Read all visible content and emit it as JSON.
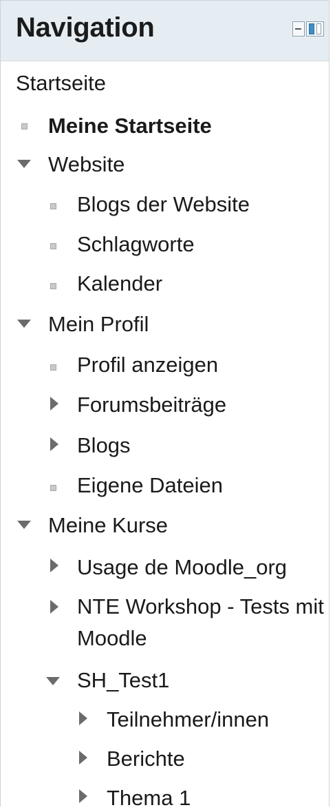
{
  "block": {
    "title": "Navigation",
    "controls": {
      "collapse_icon": "minus-box-icon",
      "dock_icon": "dock-block-icon"
    }
  },
  "tree": [
    {
      "label": "Startseite",
      "icon": "none"
    },
    {
      "label": "Meine Startseite",
      "icon": "bullet"
    },
    {
      "label": "Website",
      "icon": "expanded-arrow"
    },
    {
      "label": "Blogs der Website",
      "icon": "bullet"
    },
    {
      "label": "Schlagworte",
      "icon": "bullet"
    },
    {
      "label": "Kalender",
      "icon": "bullet"
    },
    {
      "label": "Mein Profil",
      "icon": "expanded-arrow"
    },
    {
      "label": "Profil anzeigen",
      "icon": "bullet"
    },
    {
      "label": "Forumsbeiträge",
      "icon": "collapsed-arrow"
    },
    {
      "label": "Blogs",
      "icon": "collapsed-arrow"
    },
    {
      "label": "Eigene Dateien",
      "icon": "bullet"
    },
    {
      "label": "Meine Kurse",
      "icon": "expanded-arrow"
    },
    {
      "label": "Usage de Moodle_org",
      "icon": "collapsed-arrow"
    },
    {
      "label": "NTE Workshop - Tests mit Moodle",
      "icon": "collapsed-arrow"
    },
    {
      "label": "SH_Test1",
      "icon": "expanded-arrow"
    },
    {
      "label": "Teilnehmer/innen",
      "icon": "collapsed-arrow"
    },
    {
      "label": "Berichte",
      "icon": "collapsed-arrow"
    },
    {
      "label": "Thema 1",
      "icon": "collapsed-arrow"
    }
  ],
  "colors": {
    "header_bg": "#e6edf2",
    "border": "#c9d3da",
    "text": "#1a1a1a",
    "arrow": "#6b6b6b",
    "bullet": "#c9c9c9",
    "dock_accent": "#3f8fc6"
  }
}
